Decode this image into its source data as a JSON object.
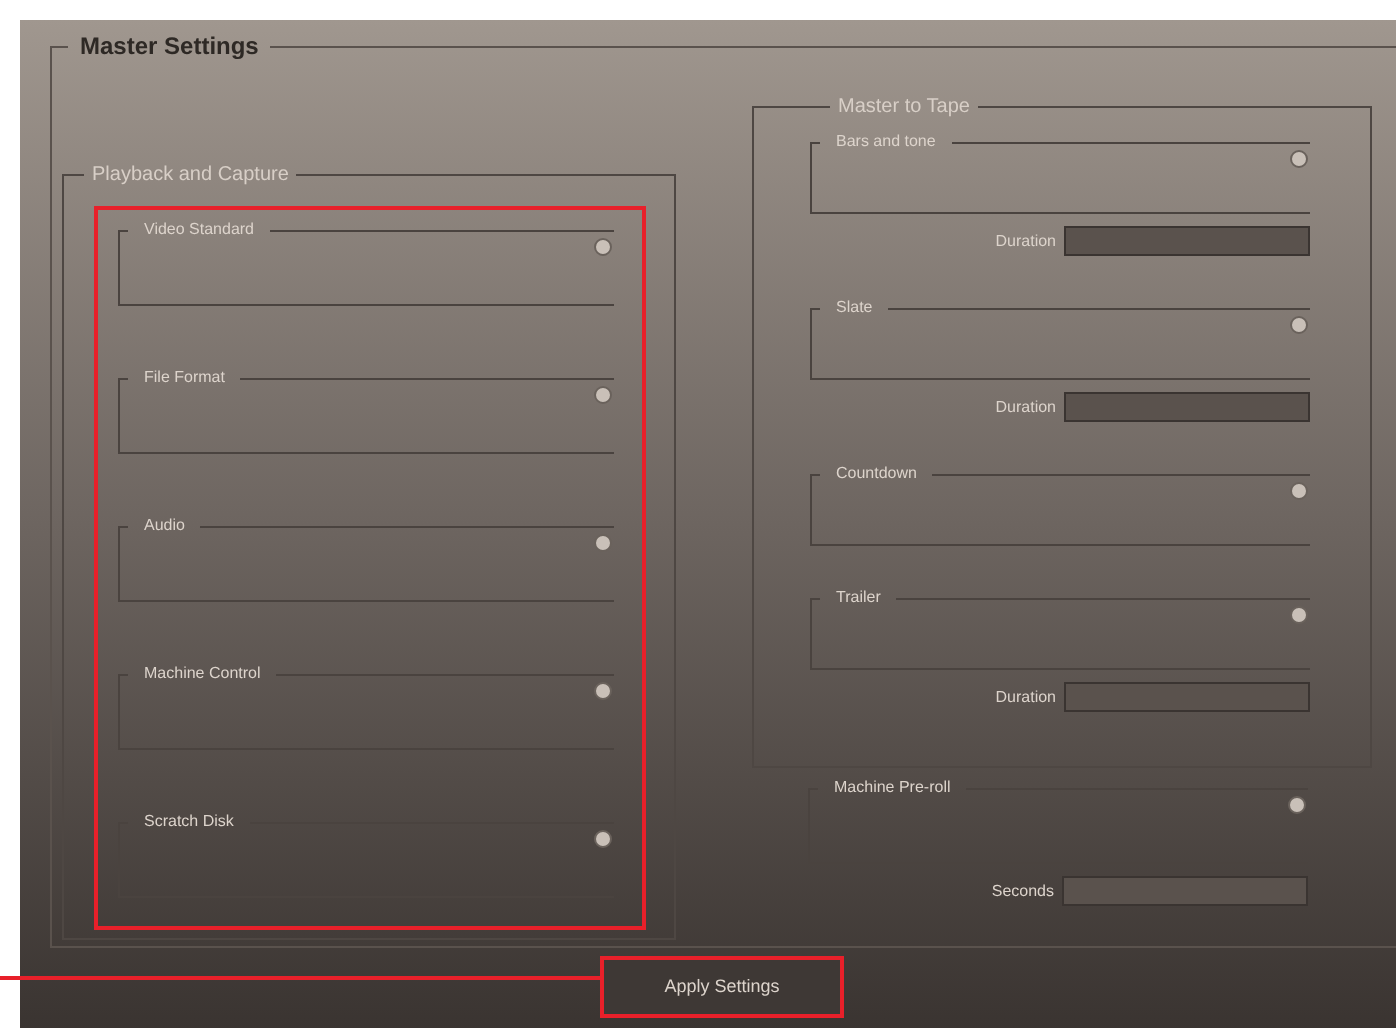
{
  "window": {
    "title": "Master Settings"
  },
  "playback_and_capture": {
    "title": "Playback and Capture",
    "highlighted": true,
    "dropdowns": [
      {
        "label": "Video Standard"
      },
      {
        "label": "File Format"
      },
      {
        "label": "Audio"
      },
      {
        "label": "Machine Control"
      },
      {
        "label": "Scratch Disk"
      }
    ]
  },
  "master_to_tape": {
    "title": "Master to Tape",
    "items": [
      {
        "label": "Bars and tone",
        "duration_label": "Duration"
      },
      {
        "label": "Slate",
        "duration_label": "Duration"
      },
      {
        "label": "Countdown"
      },
      {
        "label": "Trailer",
        "duration_label": "Duration"
      }
    ]
  },
  "machine_preroll": {
    "label": "Machine Pre-roll",
    "field_label": "Seconds"
  },
  "apply_button": {
    "label": "Apply Settings",
    "highlighted": true
  }
}
